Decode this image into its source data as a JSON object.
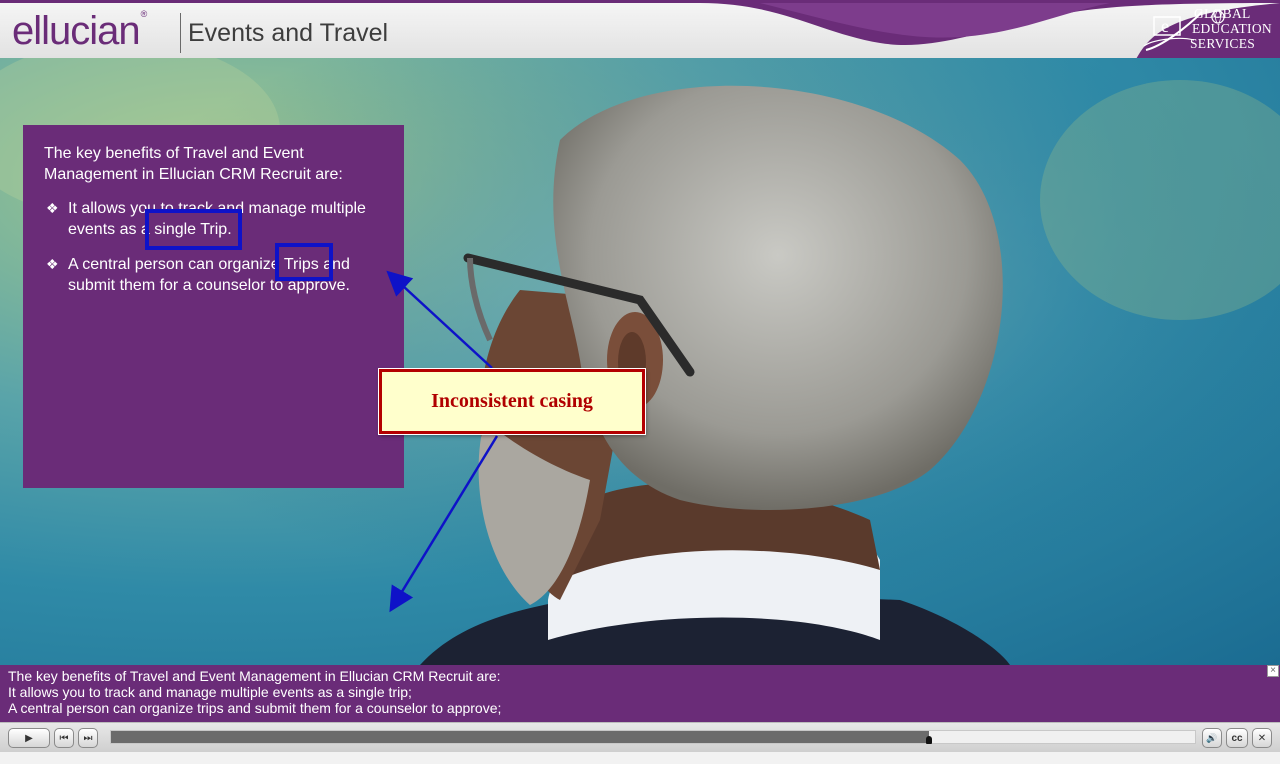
{
  "header": {
    "brand": "ellucian",
    "title": "Events and Travel",
    "partner_logo_lines": [
      "GLOBAL",
      "EDUCATION",
      "SERVICES"
    ]
  },
  "panel": {
    "intro": "The key benefits of Travel and Event Management in Ellucian CRM Recruit are:",
    "bullets": [
      "It allows you to track and manage multiple events as a single Trip.",
      "A central person can organize Trips and submit them for a counselor to approve."
    ]
  },
  "callout": {
    "text": "Inconsistent casing"
  },
  "caption": {
    "lines": [
      "The key benefits of Travel and Event Management in Ellucian CRM Recruit are:",
      "It allows you to track and manage multiple events as a single trip;",
      "A central person can organize trips and submit them for a counselor to approve;"
    ],
    "close_glyph": "×"
  },
  "player": {
    "play_glyph": "▶",
    "prev_glyph": "⏮",
    "next_glyph": "⏭",
    "volume_glyph": "🔊",
    "cc_label": "cc",
    "close_glyph": "✕",
    "progress": 0.755
  },
  "colors": {
    "brand_purple": "#6a2c78",
    "highlight_blue": "#0e12c8",
    "callout_red": "#b40000",
    "callout_fill": "#ffffcc"
  }
}
